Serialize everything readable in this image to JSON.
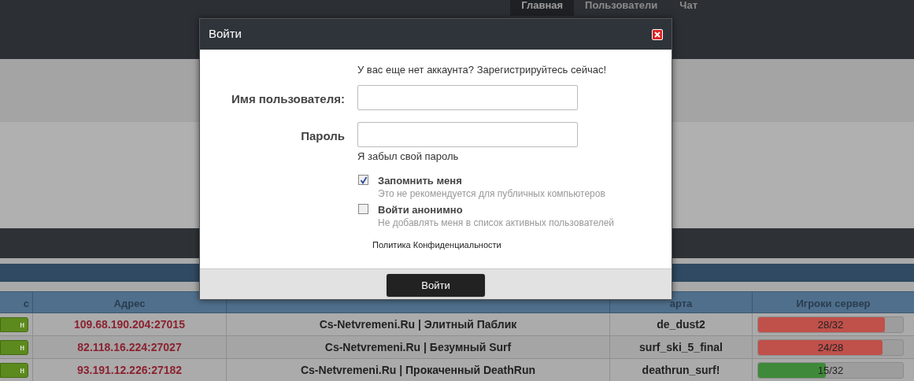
{
  "nav": {
    "tabs": [
      {
        "label": "Главная",
        "selected": true
      },
      {
        "label": "Пользователи",
        "selected": false
      },
      {
        "label": "Чат",
        "selected": false
      }
    ]
  },
  "table": {
    "columns": [
      "с",
      "Адрес",
      "арта",
      "Игроки сервер"
    ],
    "rows": [
      {
        "status": "н",
        "address": "109.68.190.204:27015",
        "name": "Cs-Netvremeni.Ru | Элитный Паблик",
        "map": "de_dust2",
        "players": "28/32",
        "level": 0.875,
        "color": "#c0504a"
      },
      {
        "status": "н",
        "address": "82.118.16.224:27027",
        "name": "Cs-Netvremeni.Ru | Безумный Surf",
        "map": "surf_ski_5_final",
        "players": "24/28",
        "level": 0.857,
        "color": "#c0504a"
      },
      {
        "status": "н",
        "address": "93.191.12.226:27182",
        "name": "Cs-Netvremeni.Ru | Прокаченный DeathRun",
        "map": "deathrun_surf!",
        "players": "15/32",
        "level": 0.47,
        "color": "#3f8a3a"
      }
    ]
  },
  "dialog": {
    "title": "Войти",
    "register_text": "У вас еще нет аккаунта? Зарегистрируйтесь сейчас!",
    "fields": [
      {
        "label": "Имя пользователя:"
      },
      {
        "label": "Пароль"
      }
    ],
    "forgot_link": "Я забыл свой пароль",
    "options": [
      {
        "label": "Запомнить меня",
        "hint": "Это не рекомендуется для публичных компьютеров",
        "checked": true
      },
      {
        "label": "Войти анонимно",
        "hint": "Не добавлять меня в список активных пользователей",
        "checked": false
      }
    ],
    "privacy_link": "Политика Конфиденциальности",
    "submit": "Войти"
  }
}
